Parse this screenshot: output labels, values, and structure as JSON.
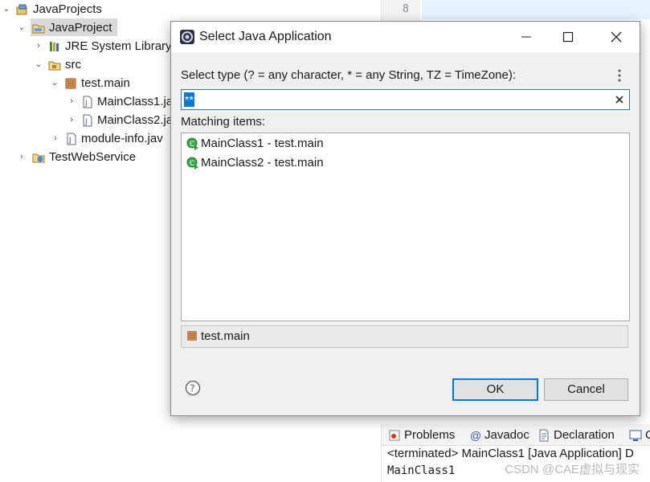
{
  "explorer": {
    "items": [
      {
        "label": "JavaProjects"
      },
      {
        "label": "JavaProject"
      },
      {
        "label": "JRE System Library"
      },
      {
        "label": "src"
      },
      {
        "label": "test.main"
      },
      {
        "label": "MainClass1.ja"
      },
      {
        "label": "MainClass2.ja"
      },
      {
        "label": "module-info.jav"
      },
      {
        "label": "TestWebService"
      }
    ]
  },
  "editor": {
    "line_number": "8"
  },
  "dialog": {
    "title": "Select Java Application",
    "prompt": "Select type (? = any character, * = any String, TZ = TimeZone):",
    "filter_value": "**",
    "matching_label": "Matching items:",
    "items": [
      {
        "label": "MainClass1 - test.main"
      },
      {
        "label": "MainClass2 - test.main"
      }
    ],
    "package": "test.main",
    "ok_label": "OK",
    "cancel_label": "Cancel"
  },
  "console": {
    "tabs": [
      {
        "label": "Problems"
      },
      {
        "label": "Javadoc"
      },
      {
        "label": "Declaration"
      },
      {
        "label": "C"
      }
    ],
    "status": "<terminated> MainClass1 [Java Application] D",
    "output": "MainClass1",
    "watermark": "CSDN @CAE虚拟与现实"
  },
  "colors": {
    "accent": "#0078d7",
    "selection": "#d9d9d9",
    "dialog_bg": "#f0f0f0"
  }
}
